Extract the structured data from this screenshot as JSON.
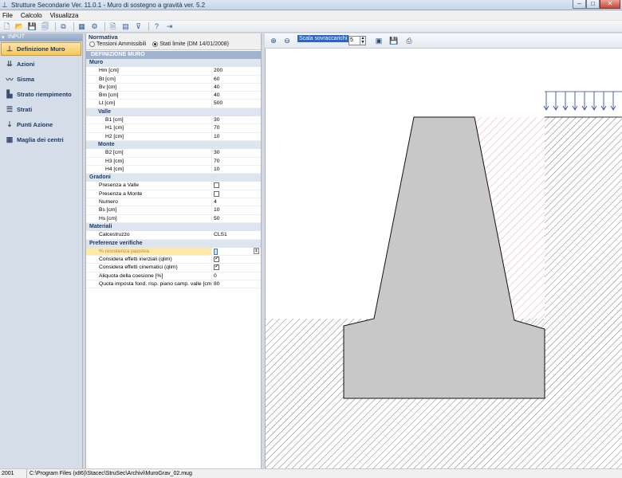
{
  "window": {
    "title": "Strutture Secondarie Ver. 11.0.1 - Muro di sostegno a gravità ver. 5.2"
  },
  "menu": [
    "File",
    "Calcolo",
    "Visualizza"
  ],
  "nav": {
    "header": "INPUT",
    "items": [
      {
        "label": "Definizione Muro",
        "icon": "wall-icon",
        "active": true
      },
      {
        "label": "Azioni",
        "icon": "forces-icon"
      },
      {
        "label": "Sisma",
        "icon": "seismic-icon"
      },
      {
        "label": "Strato riempimento",
        "icon": "fill-layer-icon"
      },
      {
        "label": "Strati",
        "icon": "layers-icon"
      },
      {
        "label": "Punti Azione",
        "icon": "action-points-icon"
      },
      {
        "label": "Maglia dei centri",
        "icon": "grid-icon"
      }
    ]
  },
  "normativa": {
    "label": "Normativa",
    "option1": "Tensioni Ammissibili",
    "option2": "Stati limite (DM 14/01/2008)",
    "selected": "option2"
  },
  "props": {
    "section": "DEFINIZIONE MURO",
    "muro": {
      "title": "Muro",
      "rows": [
        {
          "k": "Hm [cm]",
          "v": "200"
        },
        {
          "k": "Bt [cm]",
          "v": "60"
        },
        {
          "k": "Bv [cm]",
          "v": "40"
        },
        {
          "k": "Bm [cm]",
          "v": "40"
        },
        {
          "k": "Lt [cm]",
          "v": "500"
        }
      ]
    },
    "valle": {
      "title": "Valle",
      "rows": [
        {
          "k": "B1 [cm]",
          "v": "30"
        },
        {
          "k": "H1 [cm]",
          "v": "70"
        },
        {
          "k": "H2 [cm]",
          "v": "10"
        }
      ]
    },
    "monte": {
      "title": "Monte",
      "rows": [
        {
          "k": "B2 [cm]",
          "v": "30"
        },
        {
          "k": "H3 [cm]",
          "v": "70"
        },
        {
          "k": "H4 [cm]",
          "v": "10"
        }
      ]
    },
    "gradoni": {
      "title": "Gradoni",
      "presenza_valle": "Presenza a Valle",
      "presenza_monte": "Presenza a Monte",
      "numero_k": "Numero",
      "numero_v": "4",
      "bs_k": "Bs [cm]",
      "bs_v": "10",
      "hs_k": "Hs [cm]",
      "hs_v": "50"
    },
    "materiali": {
      "title": "Materiali",
      "cls_k": "Calcestruzzo",
      "cls_v": "CLS1"
    },
    "verifiche": {
      "title": "Preferenze verifiche",
      "resistenza_passiva": "% resistenza passiva",
      "eff_inerziali": "Considera effetti inerziali (qlim)",
      "eff_cinematici": "Considera effetti cinematici (qlim)",
      "aliquota_k": "Aliquota della coesione [%]",
      "aliquota_v": "0",
      "quota_k": "Quota imposta fond. risp. piano camp. valle [cm]",
      "quota_v": "80"
    }
  },
  "drawing": {
    "scale_label": "Scala sovraccarichi",
    "scale_value": "5"
  },
  "status": {
    "left": "2001",
    "path": "C:\\Program Files (x86)\\Stacec\\StruSec\\Archivi\\MuroGrav_02.mug"
  }
}
